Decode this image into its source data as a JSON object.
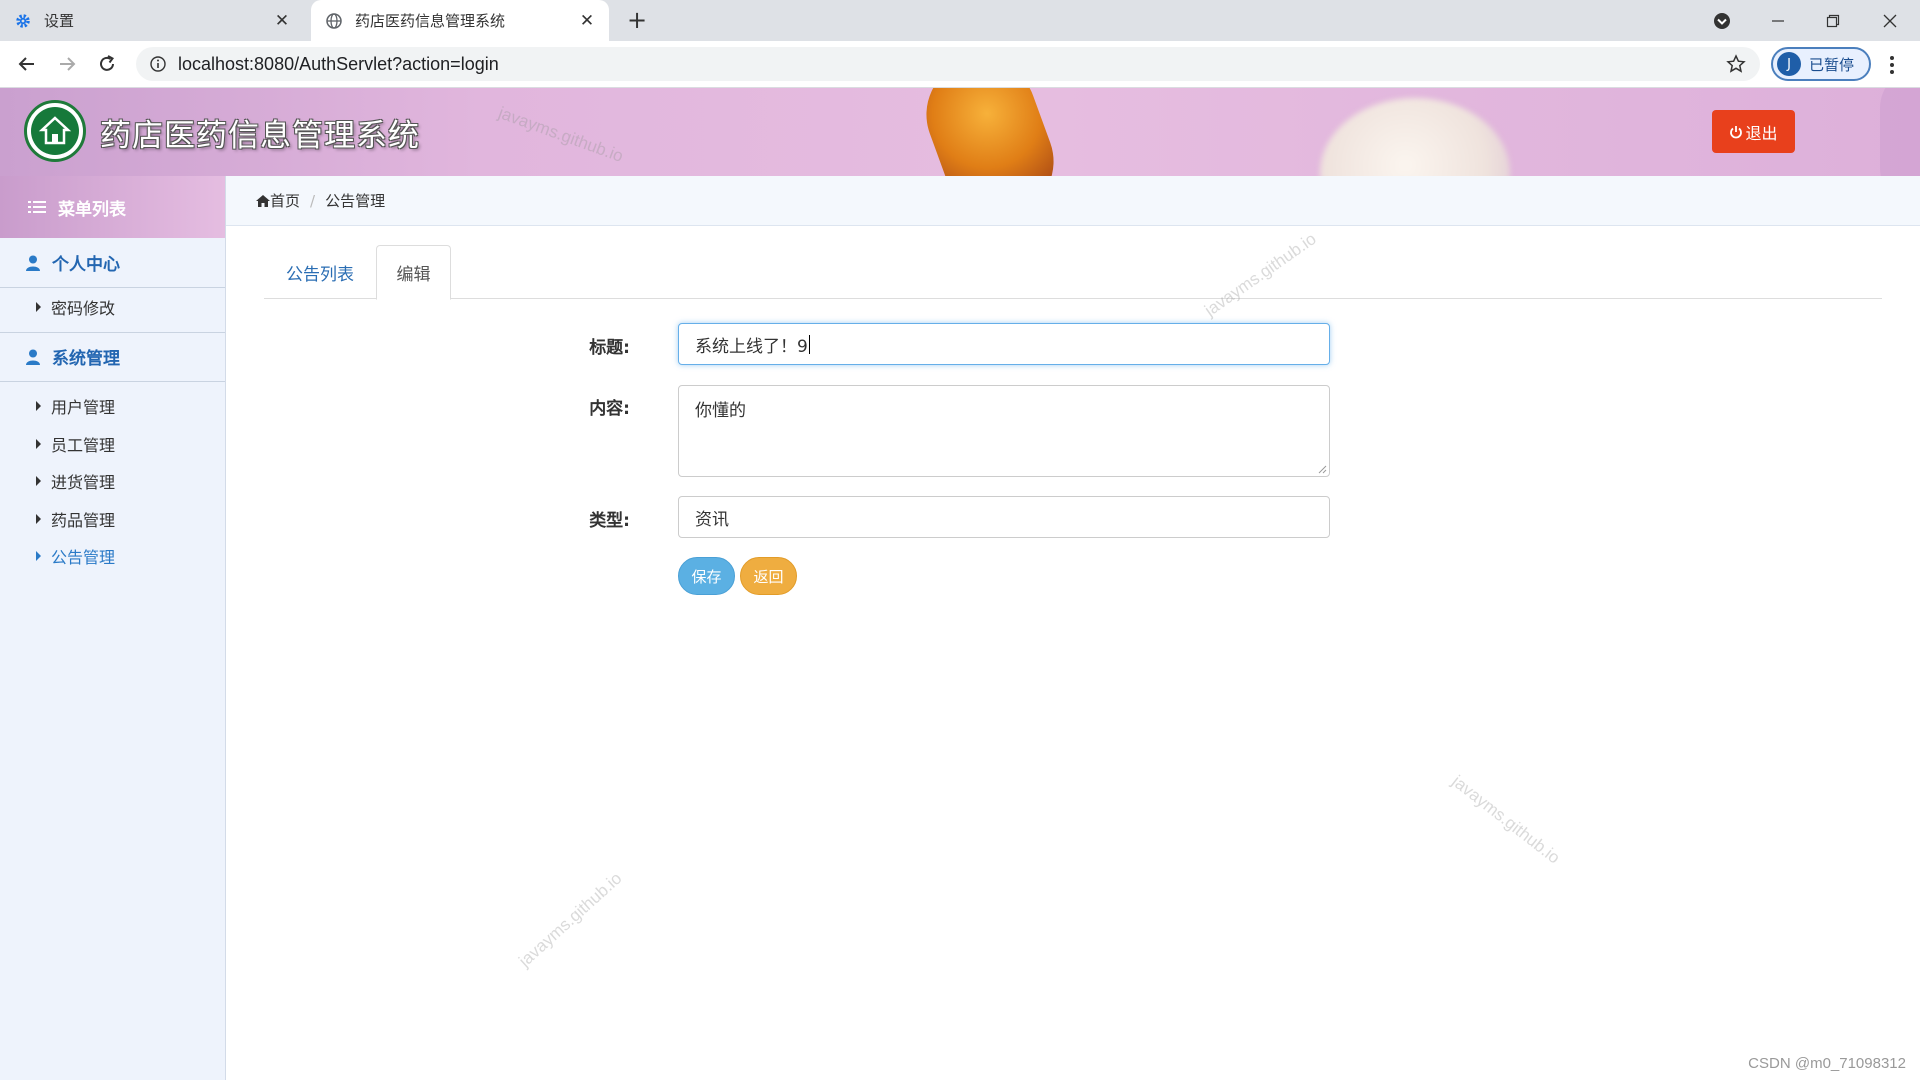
{
  "browser": {
    "tabs": [
      {
        "title": "设置",
        "icon": "gear-icon",
        "active": false
      },
      {
        "title": "药店医药信息管理系统",
        "icon": "globe-icon",
        "active": true
      }
    ],
    "url": "localhost:8080/AuthServlet?action=login",
    "profile": {
      "initial": "J",
      "status": "已暂停"
    }
  },
  "header": {
    "title": "药店医药信息管理系统",
    "logout_label": "退出"
  },
  "sidebar": {
    "heading": "菜单列表",
    "groups": [
      {
        "label": "个人中心",
        "items": [
          {
            "label": "密码修改",
            "active": false
          }
        ]
      },
      {
        "label": "系统管理",
        "items": [
          {
            "label": "用户管理",
            "active": false
          },
          {
            "label": "员工管理",
            "active": false
          },
          {
            "label": "进货管理",
            "active": false
          },
          {
            "label": "药品管理",
            "active": false
          },
          {
            "label": "公告管理",
            "active": true
          }
        ]
      }
    ]
  },
  "breadcrumb": {
    "home": "首页",
    "current": "公告管理"
  },
  "page_tabs": [
    {
      "label": "公告列表",
      "active": false
    },
    {
      "label": "编辑",
      "active": true
    }
  ],
  "form": {
    "title_label": "标题:",
    "title_value": "系统上线了！9",
    "content_label": "内容:",
    "content_value": "你懂的",
    "type_label": "类型:",
    "type_value": "资讯",
    "save_label": "保存",
    "back_label": "返回"
  },
  "watermark": "javayms.github.io",
  "footer_credit": "CSDN @m0_71098312",
  "colors": {
    "accent_blue": "#2366b1",
    "logout_red": "#e8401c",
    "save_blue": "#5bb0e3",
    "back_orange": "#efad40",
    "header_pink": "#e1b6dd"
  }
}
